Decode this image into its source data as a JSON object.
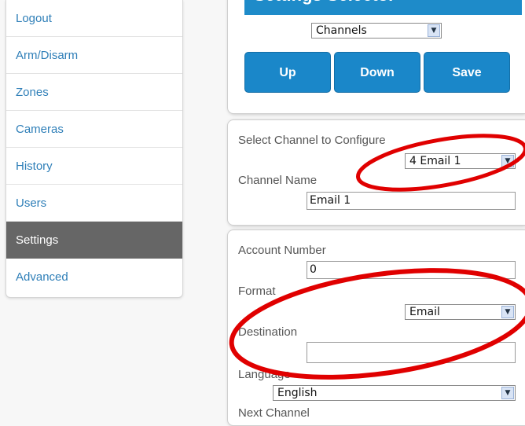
{
  "sidebar": {
    "items": [
      {
        "label": "Logout"
      },
      {
        "label": "Arm/Disarm"
      },
      {
        "label": "Zones"
      },
      {
        "label": "Cameras"
      },
      {
        "label": "History"
      },
      {
        "label": "Users"
      },
      {
        "label": "Settings"
      },
      {
        "label": "Advanced"
      }
    ],
    "active": "Settings"
  },
  "settings_selector": {
    "title": "Settings Selector",
    "selected": "Channels",
    "buttons": {
      "up": "Up",
      "down": "Down",
      "save": "Save"
    }
  },
  "channel_config": {
    "select_label": "Select Channel to Configure",
    "selected_channel": "4 Email 1",
    "name_label": "Channel Name",
    "name_value": "Email 1"
  },
  "channel_details": {
    "account_label": "Account Number",
    "account_value": "0",
    "format_label": "Format",
    "format_value": "Email",
    "destination_label": "Destination",
    "destination_value": "",
    "language_label": "Language",
    "language_value": "English",
    "next_label": "Next Channel"
  },
  "colors": {
    "accent": "#1a87c9",
    "link": "#2f7fb8",
    "active_nav": "#666666",
    "annotation": "#e00000"
  }
}
